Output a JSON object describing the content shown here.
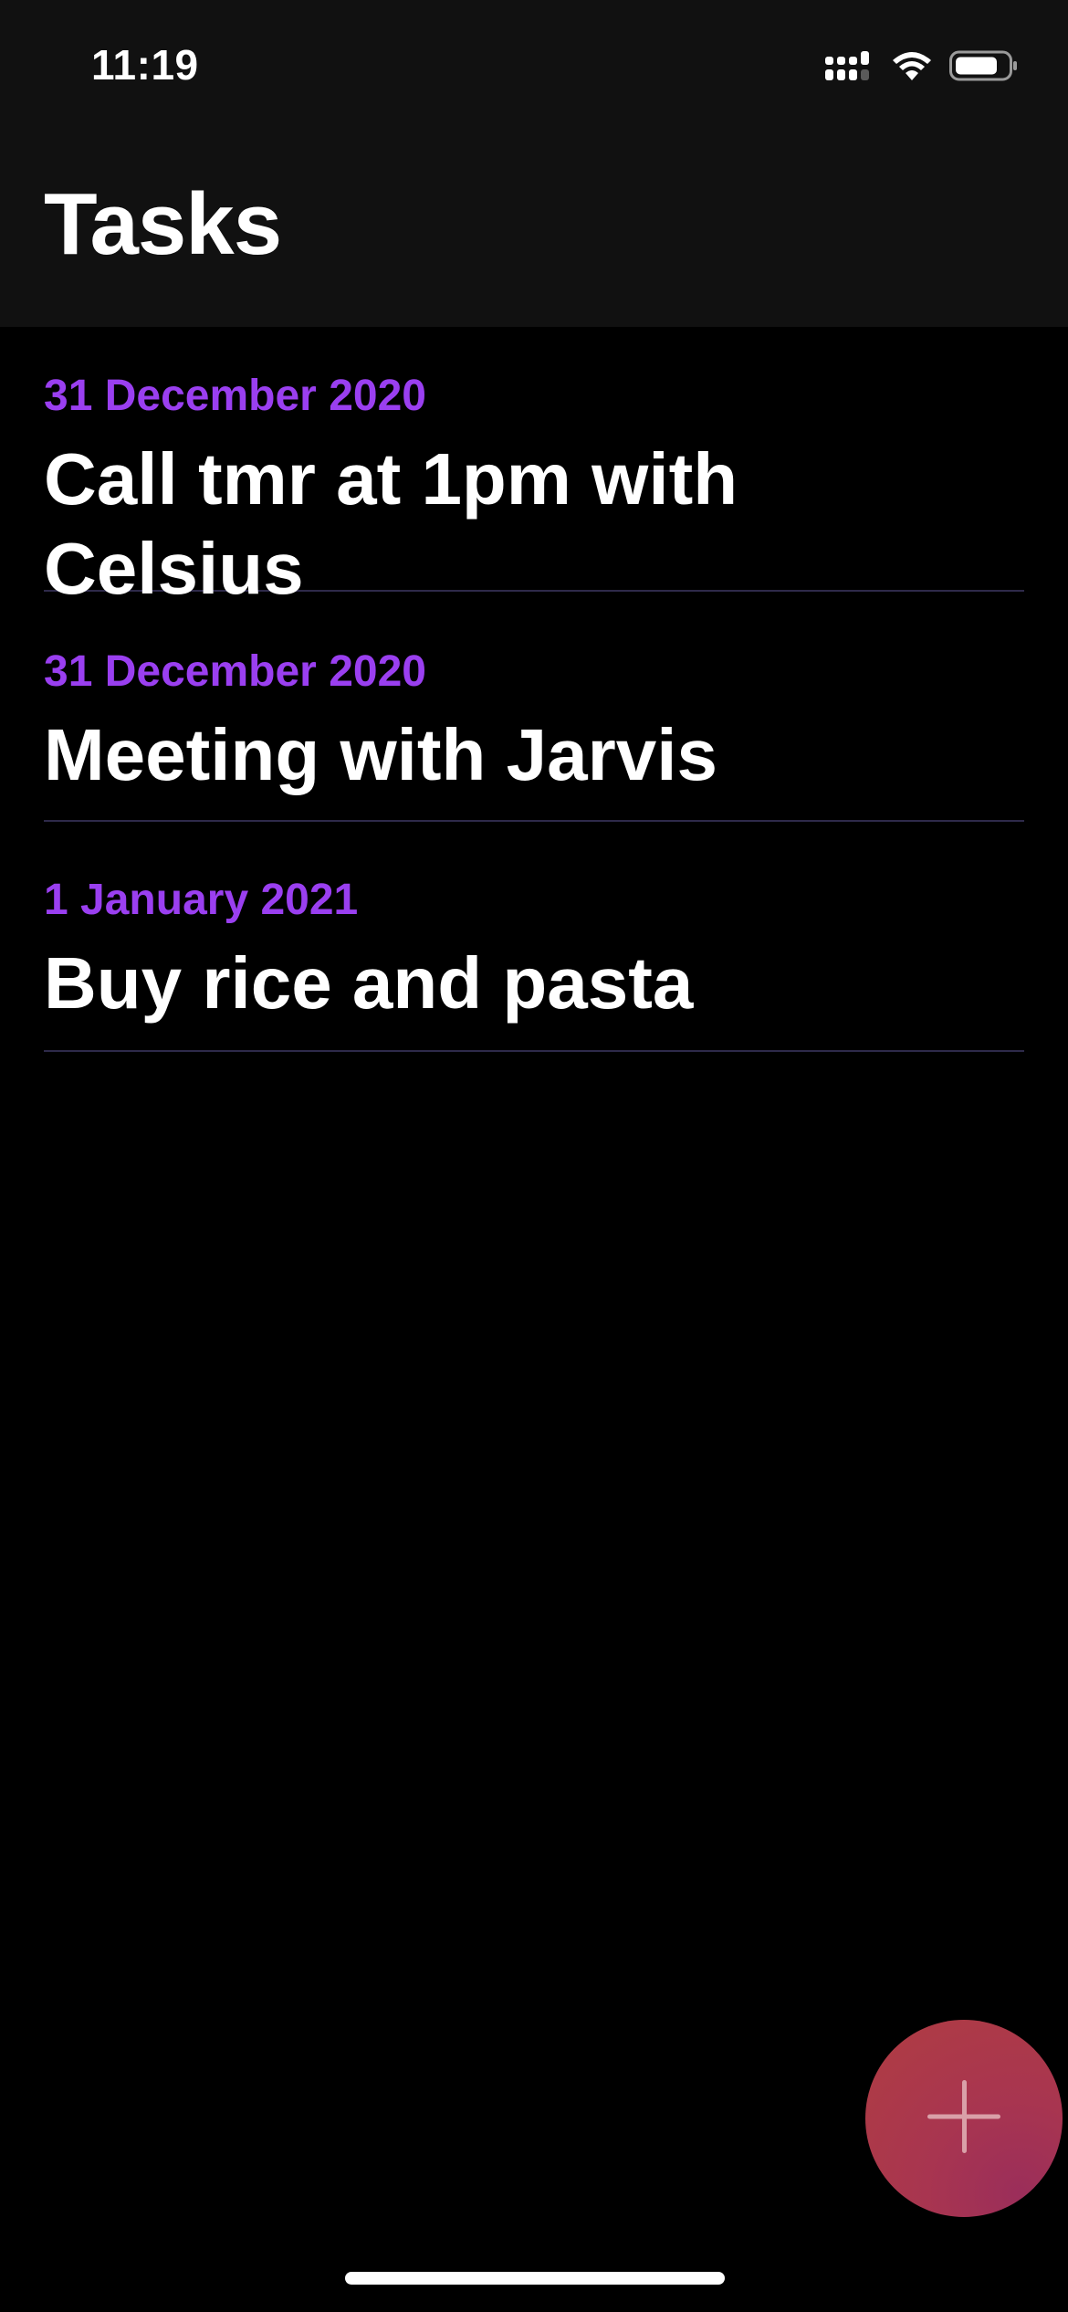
{
  "status_bar": {
    "time": "11:19",
    "icons": [
      "cellular-signal-icon",
      "wifi-icon",
      "battery-icon"
    ]
  },
  "header": {
    "title": "Tasks"
  },
  "tasks": [
    {
      "date": "31 December 2020",
      "title": "Call tmr at 1pm with Celsius"
    },
    {
      "date": "31 December 2020",
      "title": "Meeting with Jarvis"
    },
    {
      "date": "1 January 2021",
      "title": "Buy rice and pasta"
    }
  ],
  "fab": {
    "icon": "plus-icon"
  },
  "colors": {
    "accent": "#9a3ff0",
    "header_bg": "#111111",
    "background": "#000000",
    "divider": "#2e2a4a",
    "fab": "#a83550"
  }
}
